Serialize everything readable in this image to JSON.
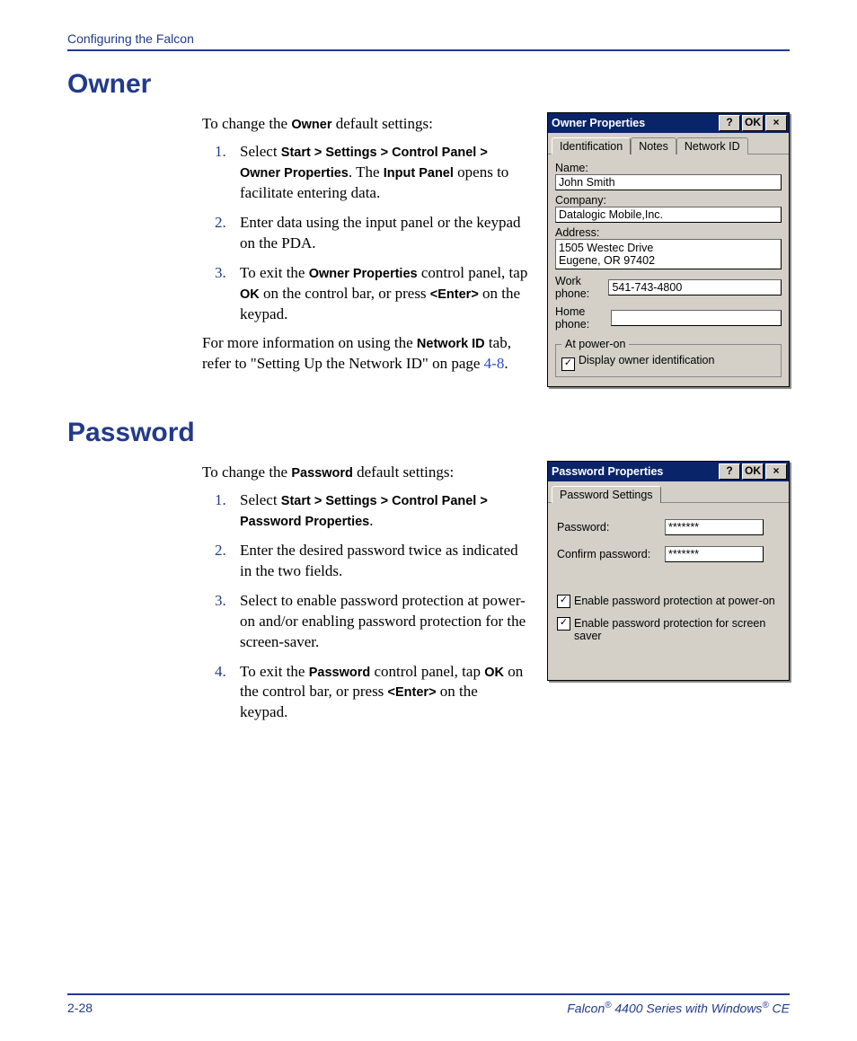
{
  "header": {
    "chapter": "Configuring the Falcon"
  },
  "owner": {
    "heading": "Owner",
    "intro_pre": "To change the ",
    "intro_bold": "Owner",
    "intro_post": " default settings:",
    "steps": [
      {
        "parts": [
          {
            "t": "Select ",
            "b": false
          },
          {
            "t": "Start > Settings > Control Panel > Owner Properties",
            "b": true
          },
          {
            "t": ". The ",
            "b": false
          },
          {
            "t": "Input Panel",
            "b": true
          },
          {
            "t": " opens to facilitate entering data.",
            "b": false
          }
        ]
      },
      {
        "parts": [
          {
            "t": "Enter data using the input panel or the keypad on the PDA.",
            "b": false
          }
        ]
      },
      {
        "parts": [
          {
            "t": "To exit the ",
            "b": false
          },
          {
            "t": "Owner Properties",
            "b": true
          },
          {
            "t": " control panel, tap ",
            "b": false
          },
          {
            "t": "OK",
            "b": true
          },
          {
            "t": " on the control bar, or press ",
            "b": false
          },
          {
            "t": "<Enter>",
            "b": true
          },
          {
            "t": " on the keypad.",
            "b": false
          }
        ]
      }
    ],
    "after_pre": "For more information on using the ",
    "after_bold": "Network ID",
    "after_mid": " tab, refer to \"Setting Up the Network ID\" on page ",
    "after_link": "4-8",
    "after_post": "."
  },
  "owner_window": {
    "title": "Owner Properties",
    "btn_help": "?",
    "btn_ok": "OK",
    "btn_close": "×",
    "tabs": [
      "Identification",
      "Notes",
      "Network ID"
    ],
    "name_label": "Name:",
    "name": "John Smith",
    "company_label": "Company:",
    "company": "Datalogic Mobile,Inc.",
    "address_label": "Address:",
    "address": "1505 Westec Drive\nEugene, OR 97402",
    "work_label": "Work phone:",
    "work": "541-743-4800",
    "home_label": "Home phone:",
    "home": "",
    "fieldset": "At power-on",
    "checkbox": "Display owner identification"
  },
  "password": {
    "heading": "Password",
    "intro_pre": "To change the ",
    "intro_bold": "Password",
    "intro_post": " default settings:",
    "steps": [
      {
        "parts": [
          {
            "t": "Select ",
            "b": false
          },
          {
            "t": "Start > Settings > Control Panel > Password Properties",
            "b": true
          },
          {
            "t": ".",
            "b": false
          }
        ]
      },
      {
        "parts": [
          {
            "t": "Enter the desired password twice as indicated in the two fields.",
            "b": false
          }
        ]
      },
      {
        "parts": [
          {
            "t": "Select to enable password protection at power-on and/or enabling password protection for the screen-saver.",
            "b": false
          }
        ]
      },
      {
        "parts": [
          {
            "t": "To exit the ",
            "b": false
          },
          {
            "t": "Password",
            "b": true
          },
          {
            "t": " control panel, tap ",
            "b": false
          },
          {
            "t": "OK",
            "b": true
          },
          {
            "t": " on the control bar, or press ",
            "b": false
          },
          {
            "t": "<Enter>",
            "b": true
          },
          {
            "t": " on the keypad.",
            "b": false
          }
        ]
      }
    ]
  },
  "password_window": {
    "title": "Password Properties",
    "btn_help": "?",
    "btn_ok": "OK",
    "btn_close": "×",
    "tab": "Password Settings",
    "pwd_label": "Password:",
    "pwd": "*******",
    "confirm_label": "Confirm password:",
    "confirm": "*******",
    "check1": "Enable password protection at power-on",
    "check2": "Enable password protection for screen saver"
  },
  "footer": {
    "page": "2-28",
    "product_pre": "Falcon",
    "product_mid": " 4400 Series with Windows",
    "product_post": " CE"
  }
}
